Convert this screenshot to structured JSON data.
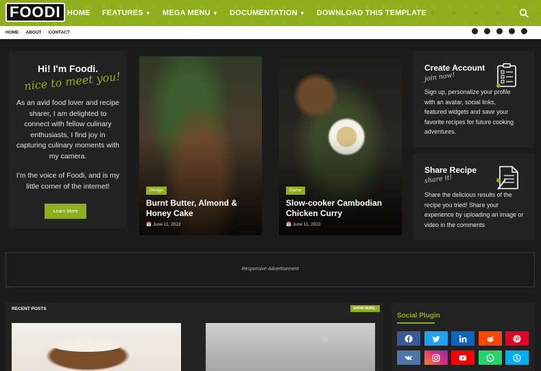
{
  "brand": {
    "logo_text": "FOODI",
    "accent": "#8fae1b"
  },
  "nav": {
    "items": [
      {
        "label": "HOME",
        "has_dropdown": false
      },
      {
        "label": "FEATURES",
        "has_dropdown": true
      },
      {
        "label": "MEGA MENU",
        "has_dropdown": true
      },
      {
        "label": "DOCUMENTATION",
        "has_dropdown": true
      },
      {
        "label": "DOWNLOAD THIS TEMPLATE",
        "has_dropdown": false
      }
    ],
    "search_icon": "search-icon"
  },
  "subnav": {
    "items": [
      "HOME",
      "ABOUT",
      "CONTACT"
    ],
    "social_icons": [
      "facebook-icon",
      "twitter-icon",
      "instagram-icon",
      "pinterest-icon",
      "skype-icon"
    ]
  },
  "intro": {
    "greeting": "Hi! I'm Foodi.",
    "script": "nice to meet you!",
    "para1": "As an avid food lover and recipe sharer, I am delighted to connect with fellow culinary enthusiasts, I find joy in capturing culinary moments with my camera.",
    "para2": "I'm the voice of Foodi, and is my little corner of the internet!",
    "button": "Learn More"
  },
  "posts": [
    {
      "tag": "Design",
      "title": "Burnt Butter, Almond & Honey Cake",
      "date": "June 11, 2022"
    },
    {
      "tag": "Game",
      "title": "Slow-cooker Cambodian Chicken Curry",
      "date": "June 11, 2022"
    }
  ],
  "sidebar": {
    "create": {
      "title": "Create Account",
      "script": "join now!",
      "text": "Sign up, personalize your profile with an avatar, social links, featured widgets and save your favorite recipes for future cooking adventures."
    },
    "share": {
      "title": "Share Recipe",
      "script": "share it!",
      "text": "Share the delicious results of the recipe you tried! Share your experience by uploading an image or video in the comments"
    }
  },
  "ad": {
    "text": "Responsive Advertisement"
  },
  "recent": {
    "title": "RECENT POSTS",
    "show_more": "SHOW MORE"
  },
  "social_plugin": {
    "title": "Social Plugin",
    "buttons": [
      {
        "icon": "facebook-icon",
        "color": "#3b5998"
      },
      {
        "icon": "twitter-icon",
        "color": "#1da1f2"
      },
      {
        "icon": "linkedin-icon",
        "color": "#0a66c2"
      },
      {
        "icon": "reddit-icon",
        "color": "#ff4500"
      },
      {
        "icon": "pinterest-icon",
        "color": "#e60023"
      },
      {
        "icon": "vk-icon",
        "color": "#4a76a8"
      },
      {
        "icon": "instagram-icon",
        "color": "#c13584"
      },
      {
        "icon": "youtube-icon",
        "color": "#ff0000"
      },
      {
        "icon": "whatsapp-icon",
        "color": "#25d366"
      },
      {
        "icon": "skype-icon",
        "color": "#00aff0"
      }
    ]
  }
}
